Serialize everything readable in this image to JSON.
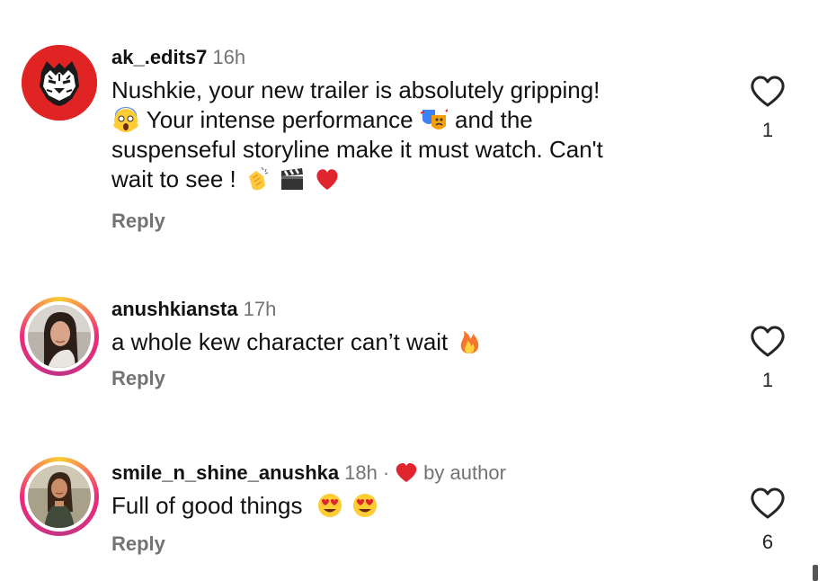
{
  "comments": [
    {
      "username": "ak_.edits7",
      "time": "16h",
      "text_1": "Nushkie, your new trailer is absolutely gripping!",
      "text_2": "Your intense performance",
      "text_3": "and the",
      "text_4": "suspenseful storyline make it must watch. Can't",
      "text_5": "wait to see !",
      "reply_label": "Reply",
      "like_count": "1"
    },
    {
      "username": "anushkiansta",
      "time": "17h",
      "text": "a whole kew character can’t wait",
      "reply_label": "Reply",
      "like_count": "1"
    },
    {
      "username": "smile_n_shine_anushka",
      "time": "18h",
      "separator": "·",
      "author_badge": "by author",
      "text": "Full of good things",
      "reply_label": "Reply",
      "like_count": "6"
    }
  ],
  "colors": {
    "heart_red": "#ed4956",
    "muted_text": "#737373",
    "story_ring": [
      "#f9ce34",
      "#ee2a7b",
      "#c13584"
    ]
  },
  "icons": [
    "tiger-avatar-icon",
    "heart-outline-icon",
    "heart-filled-icon",
    "scream-emoji-icon",
    "theater-masks-emoji-icon",
    "clapping-emoji-icon",
    "clapper-board-emoji-icon",
    "red-heart-emoji-icon",
    "fire-emoji-icon",
    "heart-eyes-emoji-icon"
  ]
}
